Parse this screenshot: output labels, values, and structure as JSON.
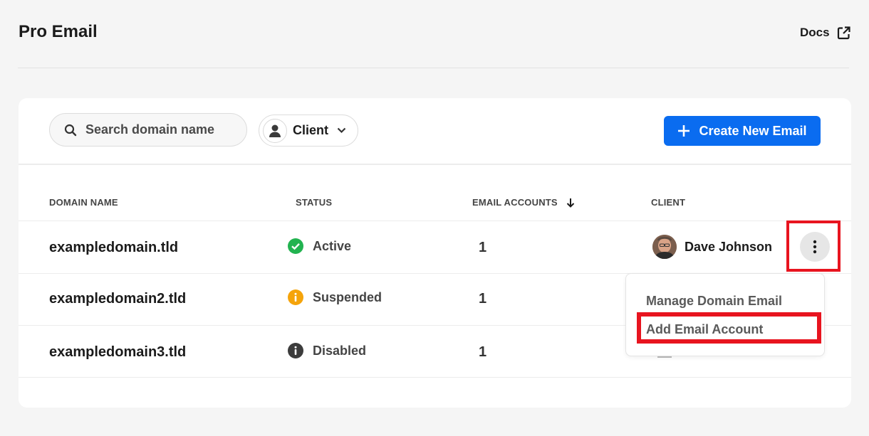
{
  "header": {
    "title": "Pro Email",
    "docs_label": "Docs",
    "docs_icon": "external-link-icon"
  },
  "toolbar": {
    "search_placeholder": "Search domain name",
    "search_value": "",
    "client_filter_label": "Client",
    "create_label": "Create New Email",
    "accent": "#0a6cf0"
  },
  "table": {
    "columns": [
      "DOMAIN NAME",
      "STATUS",
      "EMAIL ACCOUNTS",
      "CLIENT"
    ],
    "sort_column": "EMAIL ACCOUNTS",
    "sort_direction": "descending",
    "rows": [
      {
        "domain": "exampledomain.tld",
        "status": "Active",
        "status_icon": "check-circle-icon",
        "status_color": "#22b350",
        "accounts": "1",
        "client": "Dave Johnson"
      },
      {
        "domain": "exampledomain2.tld",
        "status": "Suspended",
        "status_icon": "info-circle-icon",
        "status_color": "#f5a40b",
        "accounts": "1",
        "client": ""
      },
      {
        "domain": "exampledomain3.tld",
        "status": "Disabled",
        "status_icon": "info-circle-icon",
        "status_color": "#3c3c3c",
        "accounts": "1",
        "client": ""
      }
    ]
  },
  "row_menu": {
    "items": [
      "Manage Domain Email",
      "Add Email Account"
    ],
    "highlighted_item": "Add Email Account",
    "highlight_color": "#e8141f"
  }
}
